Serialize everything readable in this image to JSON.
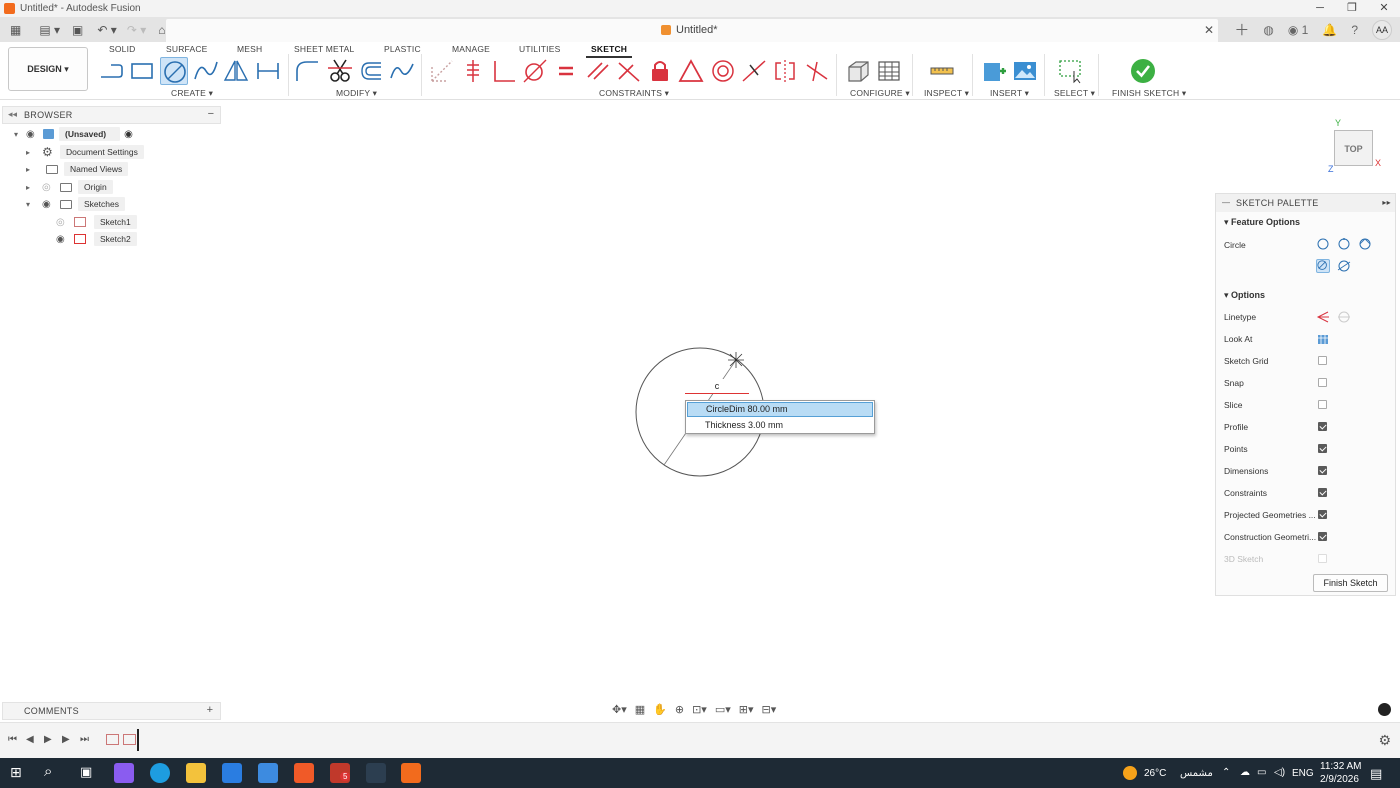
{
  "window": {
    "title": "Untitled* - Autodesk Fusion"
  },
  "doc_tab": {
    "title": "Untitled*"
  },
  "user": {
    "initials": "AA"
  },
  "notifications": {
    "count": "1"
  },
  "workspace": {
    "label": "DESIGN"
  },
  "ribbon_tabs": [
    "SOLID",
    "SURFACE",
    "MESH",
    "SHEET METAL",
    "PLASTIC",
    "MANAGE",
    "UTILITIES",
    "SKETCH"
  ],
  "active_tab": "SKETCH",
  "groups": {
    "create": "CREATE",
    "modify": "MODIFY",
    "constraints": "CONSTRAINTS",
    "configure": "CONFIGURE",
    "inspect": "INSPECT",
    "insert": "INSERT",
    "select": "SELECT",
    "finish": "FINISH SKETCH"
  },
  "browser": {
    "title": "BROWSER",
    "items": [
      {
        "label": "(Unsaved)"
      },
      {
        "label": "Document Settings"
      },
      {
        "label": "Named Views"
      },
      {
        "label": "Origin"
      },
      {
        "label": "Sketches"
      },
      {
        "label": "Sketch1"
      },
      {
        "label": "Sketch2"
      }
    ]
  },
  "canvas": {
    "dim_input": "c",
    "autocomplete": [
      {
        "name": "CircleDim",
        "value": "80.00 mm"
      },
      {
        "name": "Thickness",
        "value": "3.00 mm"
      }
    ],
    "viewcube": "TOP",
    "axis_y": "Y",
    "axis_x": "X",
    "axis_z": "Z"
  },
  "palette": {
    "title": "SKETCH PALETTE",
    "feature_options": "Feature Options",
    "circle_label": "Circle",
    "options_title": "Options",
    "rows": [
      {
        "label": "Linetype"
      },
      {
        "label": "Look At"
      },
      {
        "label": "Sketch Grid",
        "checked": false
      },
      {
        "label": "Snap",
        "checked": false
      },
      {
        "label": "Slice",
        "checked": false
      },
      {
        "label": "Profile",
        "checked": true
      },
      {
        "label": "Points",
        "checked": true
      },
      {
        "label": "Dimensions",
        "checked": true
      },
      {
        "label": "Constraints",
        "checked": true
      },
      {
        "label": "Projected Geometries ...",
        "checked": true
      },
      {
        "label": "Construction Geometri...",
        "checked": true
      },
      {
        "label": "3D Sketch",
        "checked": false
      }
    ],
    "finish_button": "Finish Sketch"
  },
  "comments": {
    "title": "COMMENTS"
  },
  "taskbar": {
    "weather_temp": "26°C",
    "weather_text": "مشمس",
    "lang": "ENG",
    "time": "11:32 AM",
    "date": "2/9/2026",
    "badge": "5"
  },
  "colors": {
    "accent": "#0696d7",
    "sketch_red": "#d9333f",
    "finish_green": "#3cb043",
    "taskbar": "#1e2a35"
  }
}
